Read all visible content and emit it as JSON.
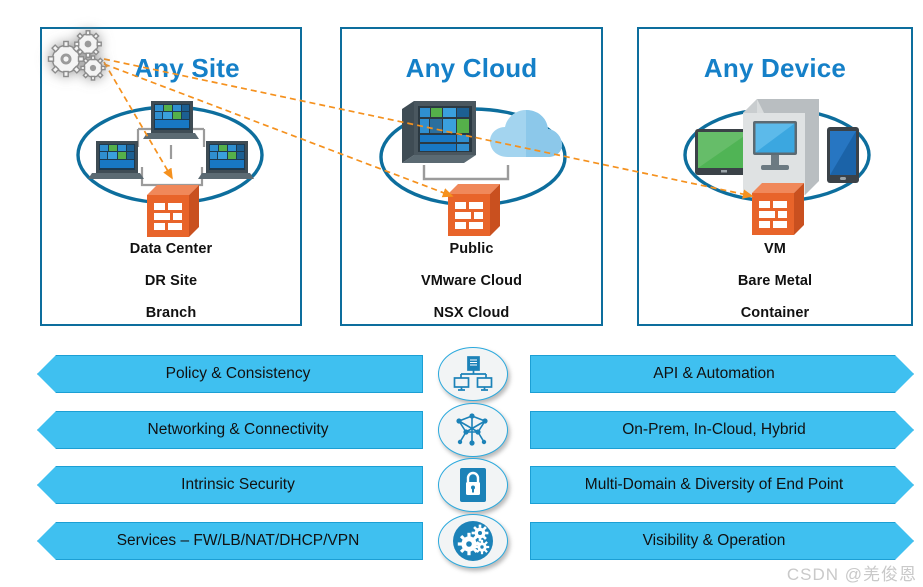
{
  "diagram": {
    "title_color": "#1580c8",
    "panel_border_color": "#0d6e9d",
    "bar_color": "#3fc0f0",
    "bar_border_color": "#1c9fd4",
    "accent_orange": "#ef7622",
    "panels": [
      {
        "id": "any-site",
        "title": "Any Site",
        "labels": [
          "Data Center",
          "DR Site",
          "Branch"
        ],
        "icons": [
          "gears-icon",
          "laptop-icon",
          "laptop-icon",
          "laptop-icon",
          "firewall-icon"
        ]
      },
      {
        "id": "any-cloud",
        "title": "Any Cloud",
        "labels": [
          "Public",
          "VMware Cloud",
          "NSX Cloud"
        ],
        "icons": [
          "server-rack-icon",
          "cloud-icon",
          "firewall-icon"
        ]
      },
      {
        "id": "any-device",
        "title": "Any Device",
        "labels": [
          "VM",
          "Bare Metal",
          "Container"
        ],
        "icons": [
          "tablet-icon",
          "desktop-monitor-icon",
          "smartphone-icon",
          "firewall-icon"
        ]
      }
    ],
    "capability_rows": [
      {
        "left": "Policy & Consistency",
        "icon": "policy-document-monitors-icon",
        "right": "API & Automation"
      },
      {
        "left": "Networking & Connectivity",
        "icon": "network-topology-icon",
        "right": "On-Prem, In-Cloud, Hybrid"
      },
      {
        "left": "Intrinsic Security",
        "icon": "padlock-icon",
        "right": "Multi-Domain & Diversity of End Point"
      },
      {
        "left": "Services – FW/LB/NAT/DHCP/VPN",
        "icon": "gears-icon",
        "right": "Visibility & Operation"
      }
    ],
    "watermark": "CSDN @羌俊恩"
  }
}
